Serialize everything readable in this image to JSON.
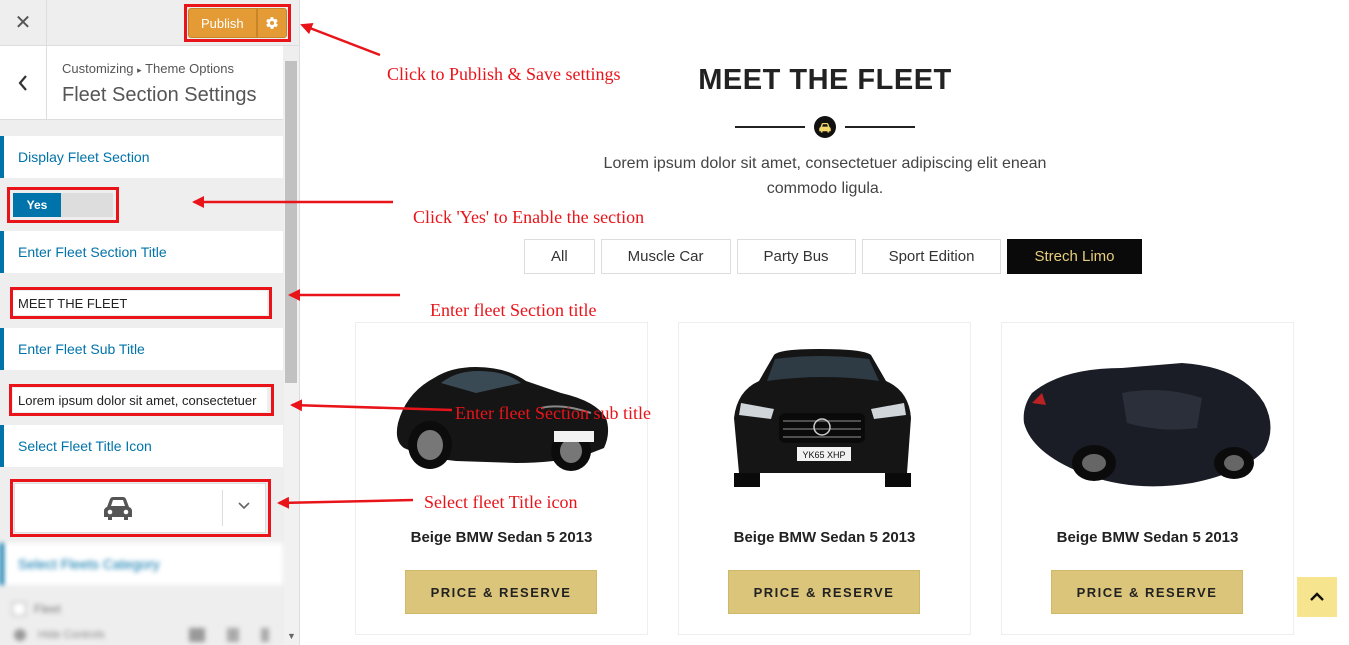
{
  "topbar": {
    "close_icon": "close-icon",
    "publish_label": "Publish",
    "settings_icon": "gear-icon"
  },
  "section_header": {
    "breadcrumb_root": "Customizing",
    "breadcrumb_sep": "▸",
    "breadcrumb_parent": "Theme Options",
    "title": "Fleet Section Settings"
  },
  "controls": {
    "display_label": "Display Fleet Section",
    "toggle_value": "Yes",
    "title_label": "Enter Fleet Section Title",
    "title_value": "MEET THE FLEET",
    "subtitle_label": "Enter Fleet Sub Title",
    "subtitle_value": "Lorem ipsum dolor sit amet, consectetuer",
    "icon_label": "Select Fleet Title Icon",
    "icon_value": "car-icon",
    "category_label": "Select Fleets Category",
    "category_option": "Fleet",
    "footer_text": "Hide Controls"
  },
  "annotations": {
    "publish": "Click to Publish & Save settings",
    "toggle": "Click 'Yes' to Enable the section",
    "title": "Enter fleet Section title",
    "subtitle": "Enter fleet Section sub title",
    "icon": "Select fleet Title icon"
  },
  "preview": {
    "title": "MEET THE FLEET",
    "subtitle": "Lorem ipsum dolor sit amet, consectetuer adipiscing elit enean commodo ligula.",
    "filters": [
      "All",
      "Muscle Car",
      "Party Bus",
      "Sport Edition",
      "Strech Limo"
    ],
    "active_filter": "Strech Limo",
    "cards": [
      {
        "name": "Beige BMW Sedan 5 2013",
        "button": "PRICE & RESERVE"
      },
      {
        "name": "Beige BMW Sedan 5 2013",
        "button": "PRICE & RESERVE",
        "plate": "YK65 XHP"
      },
      {
        "name": "Beige BMW Sedan 5 2013",
        "button": "PRICE & RESERVE"
      }
    ],
    "scroll_top_icon": "chevron-up-icon"
  },
  "colors": {
    "accent_blue": "#0073aa",
    "publish": "#e49b36",
    "annotation_red": "#e8141a",
    "gold_button": "#dbc57a",
    "active_filter_bg": "#0a0a0a",
    "active_filter_text": "#e6cd7e"
  }
}
